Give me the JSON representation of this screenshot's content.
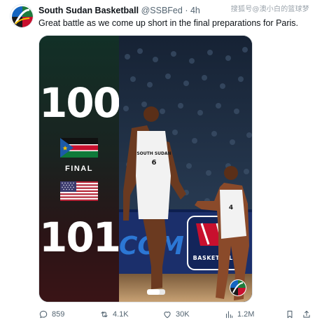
{
  "watermark": "搜狐号@澳小白的篮球梦",
  "tweet": {
    "display_name": "South Sudan Basketball",
    "handle": "@SSBFed",
    "separator": "·",
    "time": "4h",
    "text": "Great battle as we come up short in the final preparations for Paris."
  },
  "media": {
    "team_top_score": "100",
    "team_bottom_score": "101",
    "status": "FINAL",
    "team_top_flag": "south-sudan-flag",
    "team_bottom_flag": "usa-flag",
    "jersey_text": "SOUTH SUDAN",
    "court_text_left": "COM",
    "court_text_right": "BASKETBALL"
  },
  "actions": {
    "replies": "859",
    "reposts": "4.1K",
    "likes": "30K",
    "views": "1.2M"
  },
  "colors": {
    "accent": "#1d9bf0",
    "text_primary": "#0f1419",
    "text_secondary": "#536471"
  }
}
